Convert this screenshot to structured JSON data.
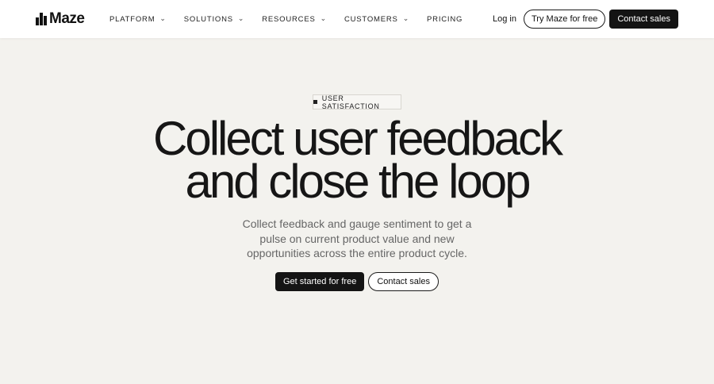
{
  "header": {
    "logo_text": "Maze",
    "nav": [
      {
        "label": "PLATFORM",
        "has_dropdown": true
      },
      {
        "label": "SOLUTIONS",
        "has_dropdown": true
      },
      {
        "label": "RESOURCES",
        "has_dropdown": true
      },
      {
        "label": "CUSTOMERS",
        "has_dropdown": true
      },
      {
        "label": "PRICING",
        "has_dropdown": false
      }
    ],
    "login_label": "Log in",
    "try_label": "Try Maze for free",
    "contact_label": "Contact sales"
  },
  "hero": {
    "tag": "USER SATISFACTION",
    "headline_line1": "Collect user feedback",
    "headline_line2": "and close the loop",
    "subtitle": "Collect feedback and gauge sentiment to get a pulse on current product value and new opportunities across the entire product cycle.",
    "primary_cta": "Get started for free",
    "secondary_cta": "Contact sales"
  },
  "icons": {
    "chevron": "chevron-down-icon",
    "logo": "maze-logo-icon"
  },
  "colors": {
    "background": "#f3f2ee",
    "header_bg": "#ffffff",
    "dark_button": "#141414",
    "text": "#161616",
    "muted_text": "#666666"
  }
}
